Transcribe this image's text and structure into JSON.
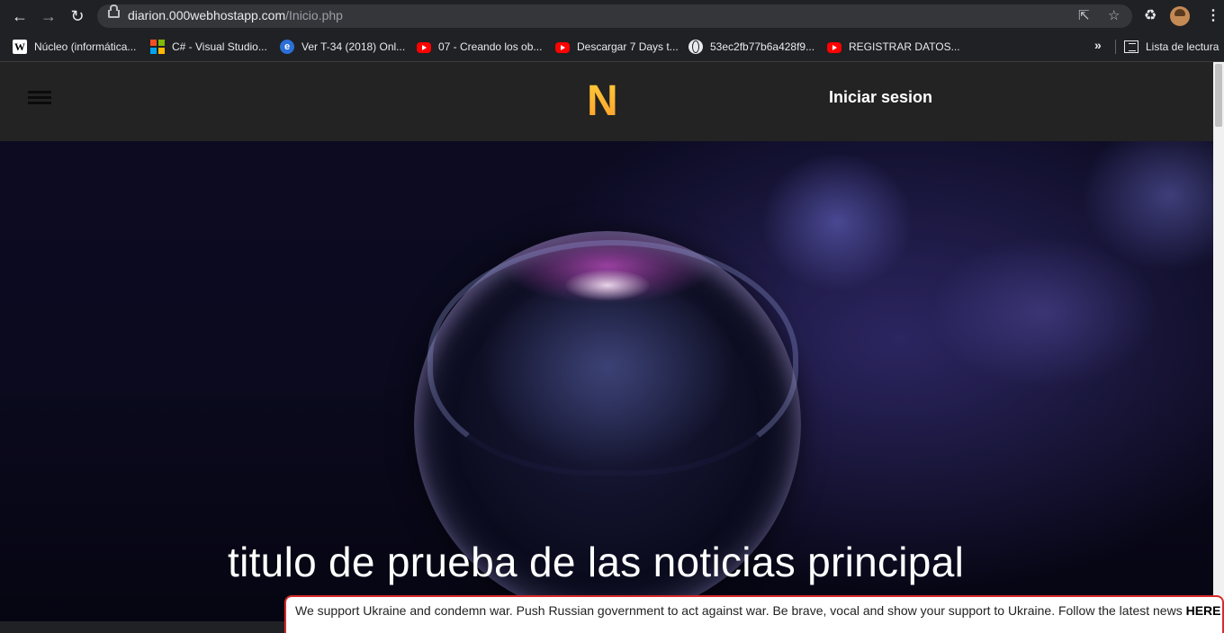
{
  "browser": {
    "url_domain": "diarion.000webhostapp.com",
    "url_path": "/Inicio.php",
    "icons": [
      "back-icon",
      "forward-icon",
      "reload-icon",
      "lock-icon",
      "share-icon",
      "star-icon",
      "extensions-icon",
      "profile-avatar",
      "menu-icon"
    ]
  },
  "bookmarks": [
    {
      "label": "Núcleo (informática...",
      "icon": "wikipedia-icon"
    },
    {
      "label": "C# - Visual Studio...",
      "icon": "microsoft-icon"
    },
    {
      "label": "Ver T-34 (2018) Onl...",
      "icon": "site-icon"
    },
    {
      "label": "07 - Creando los ob...",
      "icon": "youtube-icon"
    },
    {
      "label": "Descargar 7 Days t...",
      "icon": "youtube-icon"
    },
    {
      "label": "53ec2fb77b6a428f9...",
      "icon": "globe-icon"
    },
    {
      "label": "REGISTRAR DATOS...",
      "icon": "youtube-icon"
    }
  ],
  "bookmarks_more": "»",
  "reading_list": "Lista de lectura",
  "site": {
    "logo": "N",
    "login_label": "Iniciar sesion",
    "hero_title": "titulo de prueba de las noticias principal",
    "accent_color": "#ffa92e"
  },
  "banner": {
    "text": "We support Ukraine and condemn war. Push Russian government to act against war. Be brave, vocal and show your support to Ukraine. Follow the latest news ",
    "link": "HERE"
  }
}
